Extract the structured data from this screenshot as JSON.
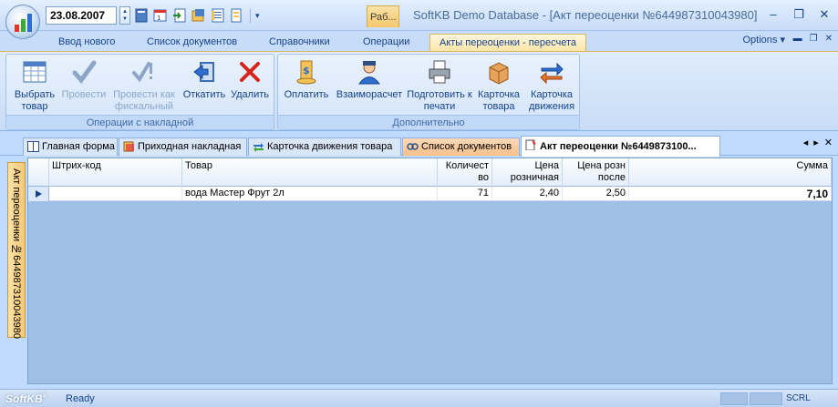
{
  "window": {
    "date": "23.08.2007",
    "context_tab": "Раб...",
    "title": "SoftKB Demo Database - [Акт переоценки №644987310043980]"
  },
  "ribbon": {
    "tabs": [
      {
        "label": "Ввод нового"
      },
      {
        "label": "Список документов"
      },
      {
        "label": "Справочники"
      },
      {
        "label": "Операции"
      },
      {
        "label": "Акты переоценки - пересчета"
      }
    ],
    "options_label": "Options",
    "groups": [
      {
        "label": "Операции с накладной",
        "buttons": [
          {
            "label": "Выбрать товар",
            "icon": "grid-select-icon",
            "enabled": true
          },
          {
            "label": "Провести",
            "icon": "checkmark-icon",
            "enabled": false
          },
          {
            "label": "Провести как фискальный",
            "icon": "check-fiscal-icon",
            "enabled": false
          },
          {
            "label": "Откатить",
            "icon": "rollback-icon",
            "enabled": true
          },
          {
            "label": "Удалить",
            "icon": "delete-x-icon",
            "enabled": true
          }
        ]
      },
      {
        "label": "Дополнительно",
        "buttons": [
          {
            "label": "Оплатить",
            "icon": "coins-icon",
            "enabled": true
          },
          {
            "label": "Взаиморасчет",
            "icon": "person-icon",
            "enabled": true
          },
          {
            "label": "Подготовить к печати",
            "icon": "printer-icon",
            "enabled": true
          },
          {
            "label": "Карточка товара",
            "icon": "box-icon",
            "enabled": true
          },
          {
            "label": "Карточка движения",
            "icon": "arrows-icon",
            "enabled": true
          }
        ]
      }
    ]
  },
  "doc_tabs": [
    {
      "label": "Главная форма",
      "icon": "form-icon"
    },
    {
      "label": "Приходная накладная",
      "icon": "invoice-icon"
    },
    {
      "label": "Карточка движения товара",
      "icon": "movement-icon"
    },
    {
      "label": "Список документов",
      "icon": "documents-icon"
    },
    {
      "label": "Акт переоценки №6449873100...",
      "icon": "act-icon"
    }
  ],
  "side_tab": "Акт переоценки №644987310043980",
  "grid": {
    "columns": [
      "Штрих-код",
      "Товар",
      "Количество",
      "Цена розничная",
      "Цена розн после",
      "Сумма"
    ],
    "column_display": [
      "Штрих-код",
      "Товар",
      "Количест во",
      "Цена розничная",
      "Цена розн после",
      "Сумма"
    ],
    "rows": [
      {
        "barcode": "",
        "product": "вода Мастер Фрут 2л",
        "qty": "71",
        "price": "2,40",
        "price_after": "2,50",
        "sum": "7,10"
      }
    ]
  },
  "status": {
    "brand": "SoftKB",
    "text": "Ready",
    "scrl": "SCRL"
  },
  "colors": {
    "accent": "#15428b",
    "background": "#bfdbff",
    "active_tab": "#fbe5a8"
  }
}
